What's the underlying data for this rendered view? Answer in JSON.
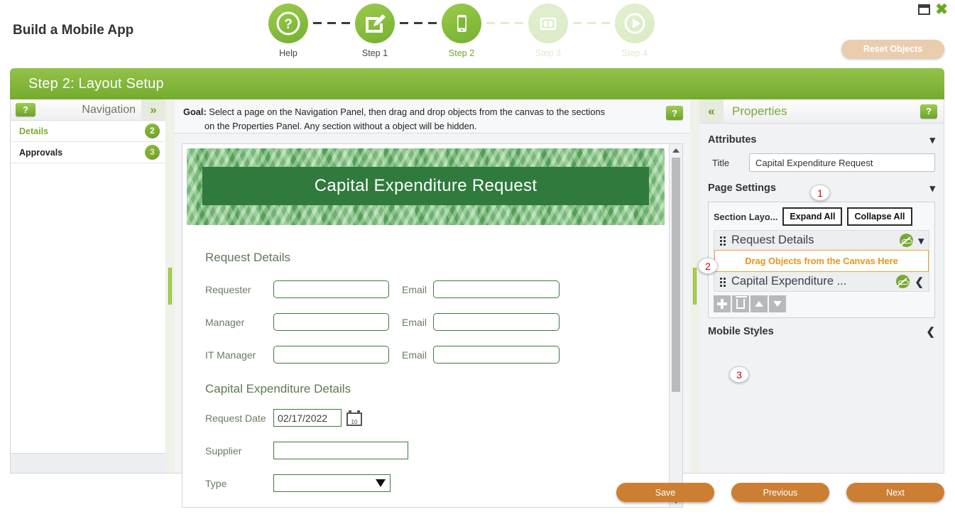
{
  "window": {
    "minimize_icon": "minimize-icon",
    "close_icon": "close-icon"
  },
  "header": {
    "title": "Build a Mobile App",
    "reset_button": "Reset Objects"
  },
  "wizard": {
    "steps": [
      {
        "label": "Help",
        "icon": "question-circle-icon",
        "state": "done"
      },
      {
        "label": "Step 1",
        "icon": "edit-document-icon",
        "state": "done"
      },
      {
        "label": "Step 2",
        "icon": "mobile-phone-icon",
        "state": "active"
      },
      {
        "label": "Step 3",
        "icon": "layout-columns-icon",
        "state": "disabled"
      },
      {
        "label": "Step 4",
        "icon": "play-circle-icon",
        "state": "disabled"
      }
    ]
  },
  "step_header": {
    "title": "Step 2: Layout Setup"
  },
  "navigation": {
    "help_label": "?",
    "title": "Navigation",
    "collapse_icon": "chevron-double-right-icon",
    "items": [
      {
        "label": "Details",
        "badge": "2",
        "selected": true
      },
      {
        "label": "Approvals",
        "badge": "3",
        "selected": false
      }
    ]
  },
  "goal": {
    "prefix": "Goal:",
    "line1": "Select a page on the Navigation Panel, then drag and drop objects from the canvas to the sections",
    "line2": "on the Properties Panel. Any section without a object will be hidden.",
    "help_label": "?"
  },
  "canvas": {
    "banner_title": "Capital Expenditure Request",
    "sections": [
      {
        "heading": "Request Details",
        "rows": [
          {
            "label": "Requester",
            "value": "",
            "email_label": "Email",
            "email_value": ""
          },
          {
            "label": "Manager",
            "value": "",
            "email_label": "Email",
            "email_value": ""
          },
          {
            "label": "IT Manager",
            "value": "",
            "email_label": "Email",
            "email_value": ""
          }
        ]
      },
      {
        "heading": "Capital Expenditure Details",
        "date_label": "Request Date",
        "date_value": "02/17/2022",
        "calendar_day": "10",
        "supplier_label": "Supplier",
        "supplier_value": "",
        "type_label": "Type",
        "type_value": ""
      }
    ]
  },
  "properties": {
    "collapse_icon": "chevron-double-left-icon",
    "title": "Properties",
    "help_label": "?",
    "attributes": {
      "heading": "Attributes",
      "title_label": "Title",
      "title_value": "Capital Expenditure Request"
    },
    "page_settings": {
      "heading": "Page Settings",
      "section_layout_label": "Section Layo...",
      "expand_all": "Expand All",
      "collapse_all": "Collapse All",
      "items": [
        {
          "name": "Request Details",
          "visibility_icon": "eye-slash-icon",
          "chevron": "chevron-down-icon"
        },
        {
          "name": "Capital Expenditure ...",
          "visibility_icon": "eye-slash-icon",
          "chevron": "chevron-left-icon"
        }
      ],
      "drop_zone_text": "Drag Objects from the Canvas Here",
      "toolbar": [
        {
          "icon": "add-icon"
        },
        {
          "icon": "delete-icon"
        },
        {
          "icon": "move-up-icon"
        },
        {
          "icon": "move-down-icon"
        }
      ]
    },
    "mobile_styles": {
      "heading": "Mobile Styles",
      "chevron": "chevron-left-icon"
    }
  },
  "markers": [
    {
      "value": "1"
    },
    {
      "value": "2"
    },
    {
      "value": "3"
    }
  ],
  "footer": {
    "buttons": [
      {
        "label": "Save"
      },
      {
        "label": "Previous"
      },
      {
        "label": "Next"
      }
    ]
  },
  "colors": {
    "brand_green": "#7aa832",
    "header_green": "#74ab2e",
    "orange_button": "#cc7f33",
    "drop_zone_orange": "#e8941c",
    "marker_red": "#d20000"
  }
}
